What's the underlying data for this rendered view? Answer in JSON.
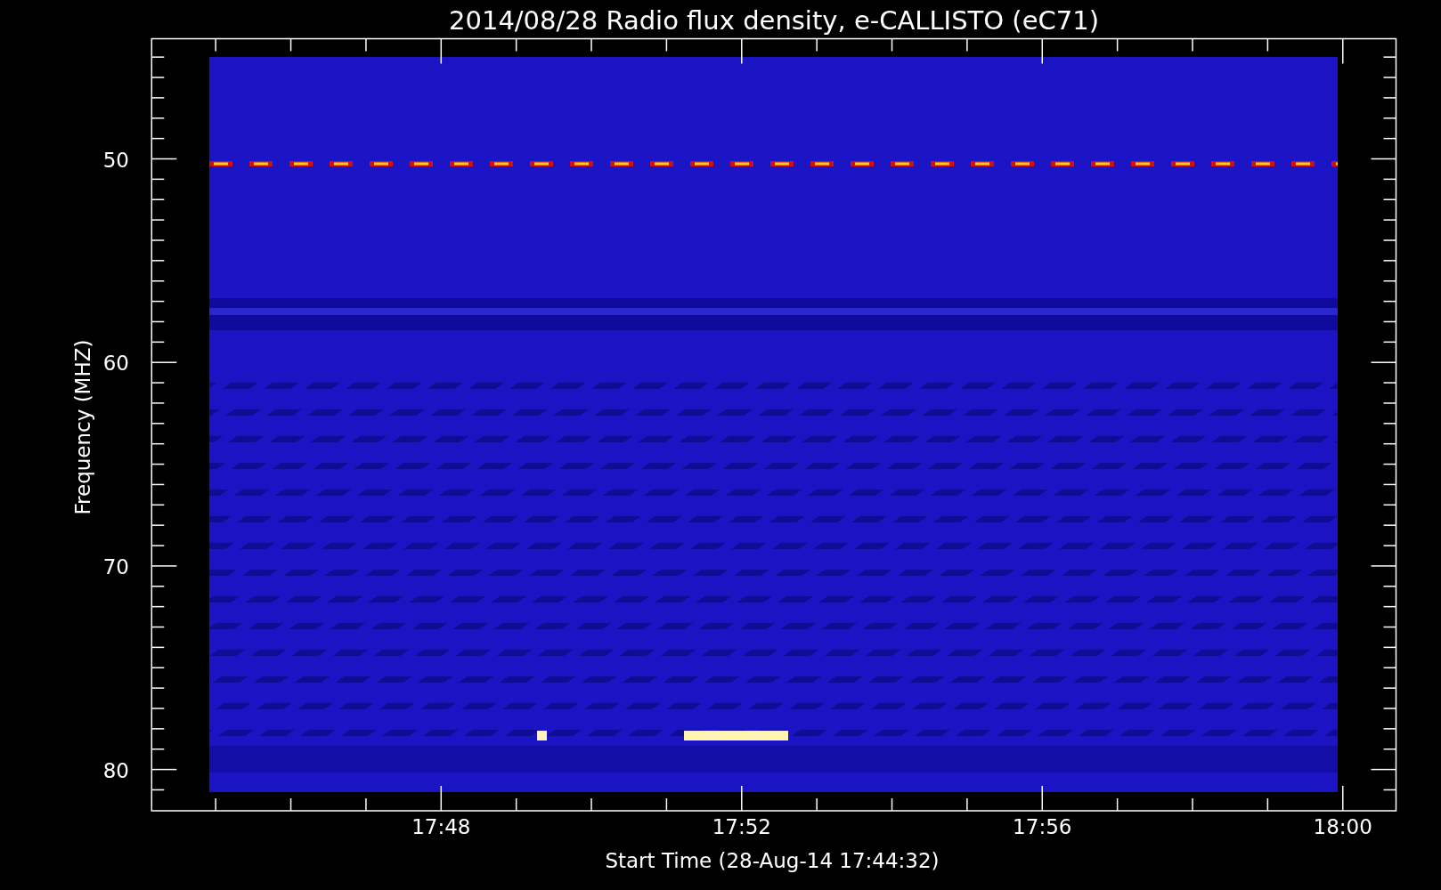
{
  "title": "2014/08/28  Radio flux density, e-CALLISTO (eC71)",
  "y_axis": {
    "label": "Frequency (MHZ)",
    "ticks": [
      "50",
      "60",
      "70",
      "80"
    ]
  },
  "x_axis": {
    "label": "Start Time (28-Aug-14 17:44:32)",
    "ticks": [
      "17:48",
      "17:52",
      "17:56",
      "18:00"
    ]
  }
}
